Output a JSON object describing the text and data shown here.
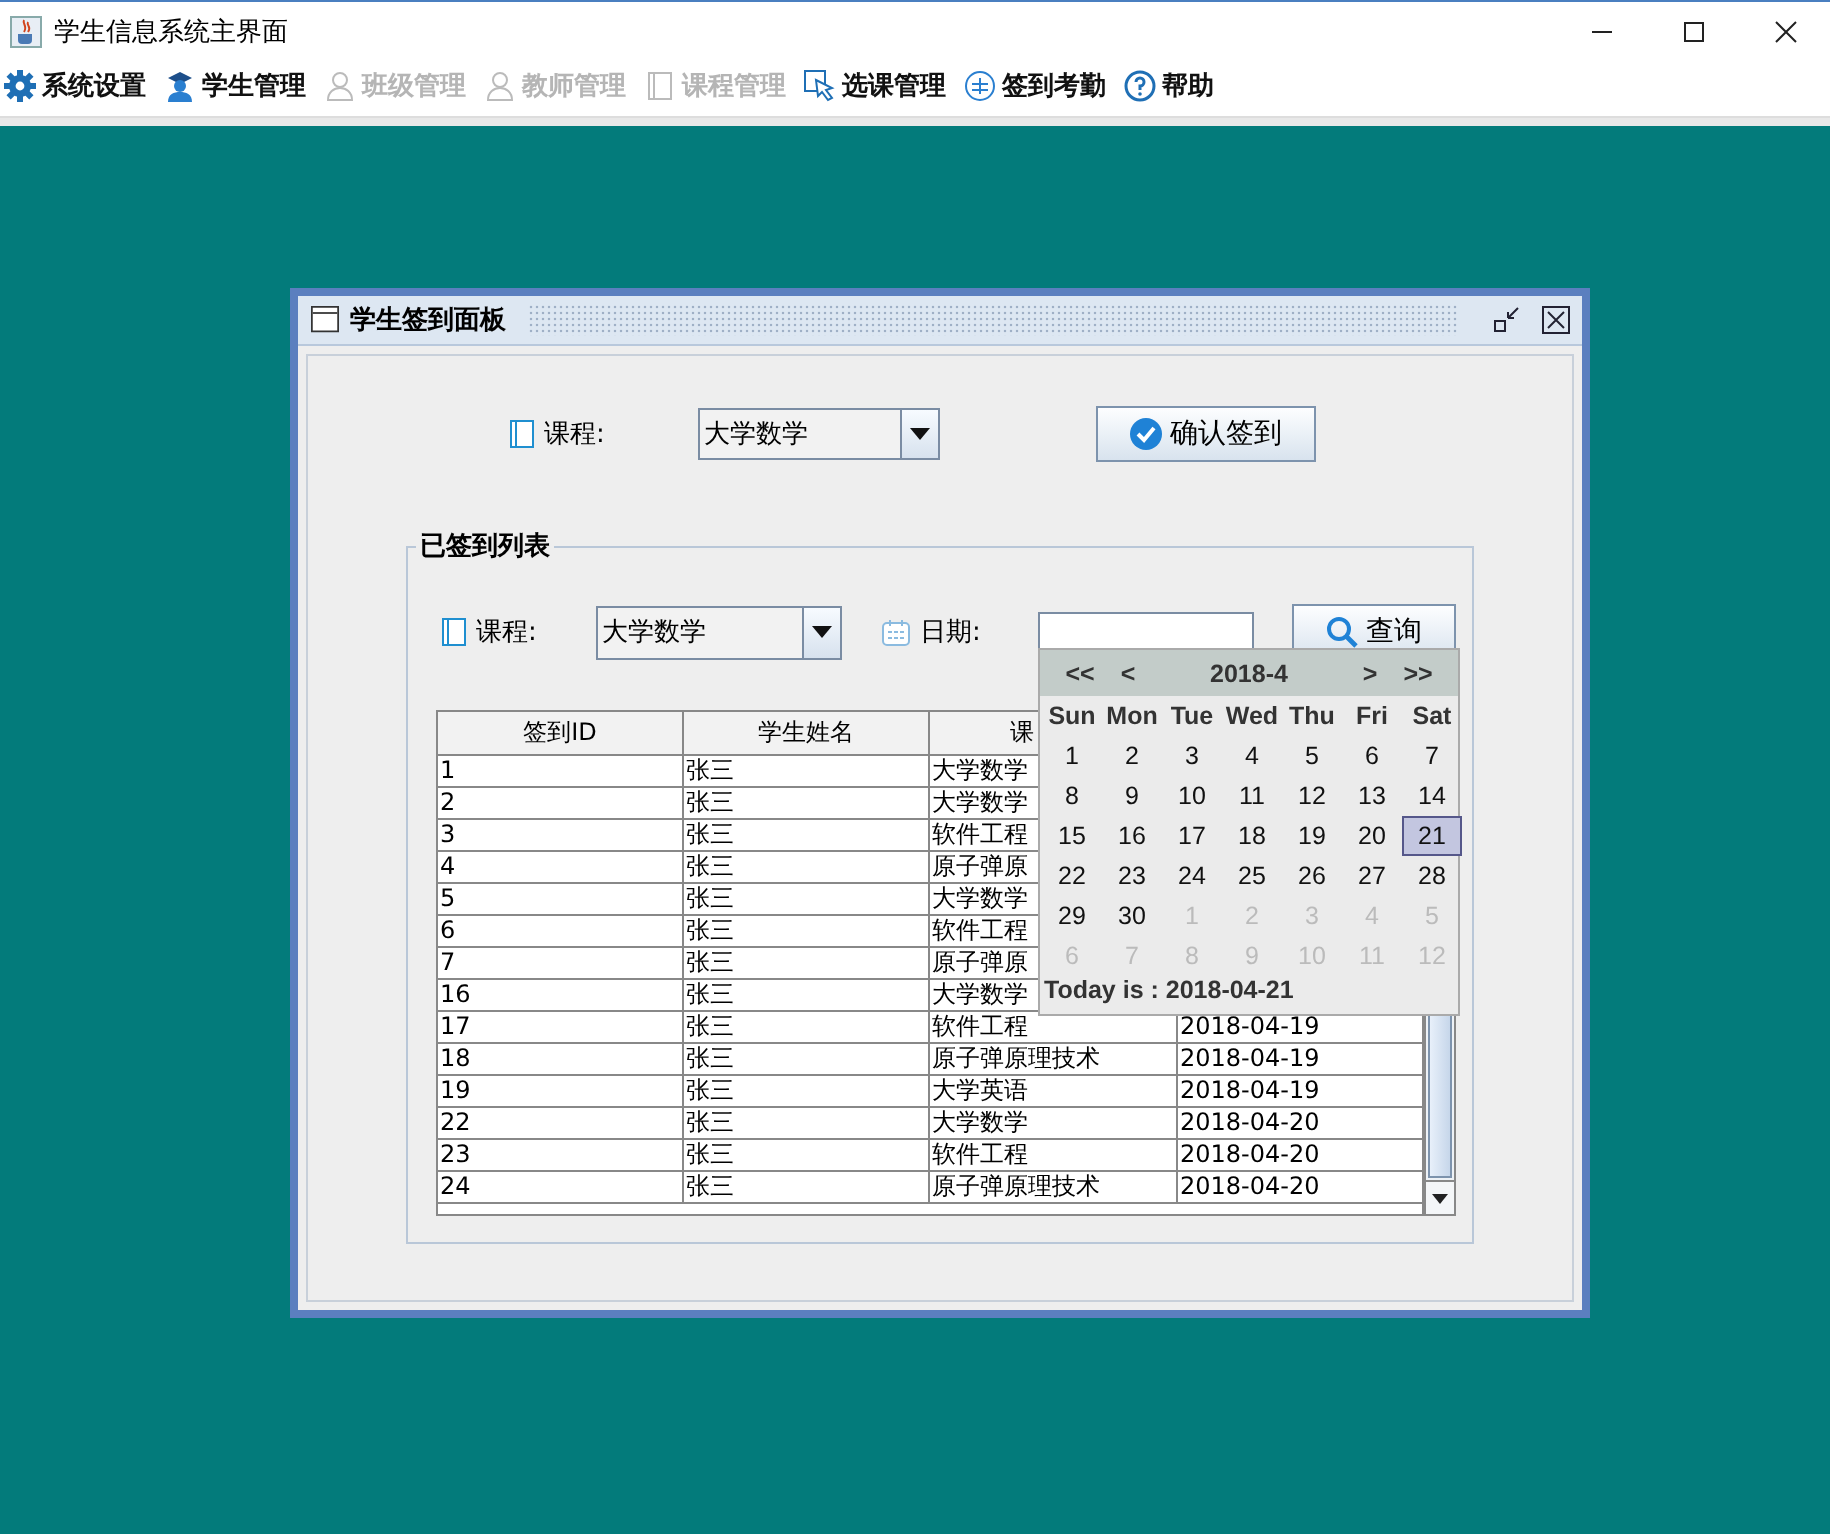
{
  "window": {
    "title": "学生信息系统主界面"
  },
  "menu": [
    {
      "label": "系统设置",
      "disabled": false
    },
    {
      "label": "学生管理",
      "disabled": false
    },
    {
      "label": "班级管理",
      "disabled": true
    },
    {
      "label": "教师管理",
      "disabled": true
    },
    {
      "label": "课程管理",
      "disabled": true
    },
    {
      "label": "选课管理",
      "disabled": false
    },
    {
      "label": "签到考勤",
      "disabled": false
    },
    {
      "label": "帮助",
      "disabled": false
    }
  ],
  "panel": {
    "title": "学生签到面板",
    "sign_in": {
      "course_label": "课程:",
      "course_value": "大学数学",
      "button": "确认签到"
    },
    "list": {
      "title": "已签到列表",
      "course_label": "课程:",
      "course_value": "大学数学",
      "date_label": "日期:",
      "search_button": "查询",
      "columns": [
        "签到ID",
        "学生姓名",
        "课"
      ],
      "rows": [
        {
          "id": "1",
          "name": "张三",
          "course": "大学数学"
        },
        {
          "id": "2",
          "name": "张三",
          "course": "大学数学"
        },
        {
          "id": "3",
          "name": "张三",
          "course": "软件工程"
        },
        {
          "id": "4",
          "name": "张三",
          "course": "原子弹原"
        },
        {
          "id": "5",
          "name": "张三",
          "course": "大学数学"
        },
        {
          "id": "6",
          "name": "张三",
          "course": "软件工程"
        },
        {
          "id": "7",
          "name": "张三",
          "course": "原子弹原"
        },
        {
          "id": "16",
          "name": "张三",
          "course": "大学数学"
        },
        {
          "id": "17",
          "name": "张三",
          "course": "软件工程",
          "date": "2018-04-19"
        },
        {
          "id": "18",
          "name": "张三",
          "course": "原子弹原理技术",
          "date": "2018-04-19"
        },
        {
          "id": "19",
          "name": "张三",
          "course": "大学英语",
          "date": "2018-04-19"
        },
        {
          "id": "22",
          "name": "张三",
          "course": "大学数学",
          "date": "2018-04-20"
        },
        {
          "id": "23",
          "name": "张三",
          "course": "软件工程",
          "date": "2018-04-20"
        },
        {
          "id": "24",
          "name": "张三",
          "course": "原子弹原理技术",
          "date": "2018-04-20"
        }
      ],
      "calendar": {
        "nav": [
          "<<",
          "<",
          "2018-4",
          ">",
          ">>"
        ],
        "weekdays": [
          "Sun",
          "Mon",
          "Tue",
          "Wed",
          "Thu",
          "Fri",
          "Sat"
        ],
        "days": [
          {
            "label": "1",
            "outside": false,
            "selected": false
          },
          {
            "label": "2",
            "outside": false,
            "selected": false
          },
          {
            "label": "3",
            "outside": false,
            "selected": false
          },
          {
            "label": "4",
            "outside": false,
            "selected": false
          },
          {
            "label": "5",
            "outside": false,
            "selected": false
          },
          {
            "label": "6",
            "outside": false,
            "selected": false
          },
          {
            "label": "7",
            "outside": false,
            "selected": false
          },
          {
            "label": "8",
            "outside": false,
            "selected": false
          },
          {
            "label": "9",
            "outside": false,
            "selected": false
          },
          {
            "label": "10",
            "outside": false,
            "selected": false
          },
          {
            "label": "11",
            "outside": false,
            "selected": false
          },
          {
            "label": "12",
            "outside": false,
            "selected": false
          },
          {
            "label": "13",
            "outside": false,
            "selected": false
          },
          {
            "label": "14",
            "outside": false,
            "selected": false
          },
          {
            "label": "15",
            "outside": false,
            "selected": false
          },
          {
            "label": "16",
            "outside": false,
            "selected": false
          },
          {
            "label": "17",
            "outside": false,
            "selected": false
          },
          {
            "label": "18",
            "outside": false,
            "selected": false
          },
          {
            "label": "19",
            "outside": false,
            "selected": false
          },
          {
            "label": "20",
            "outside": false,
            "selected": false
          },
          {
            "label": "21",
            "outside": false,
            "selected": true
          },
          {
            "label": "22",
            "outside": false,
            "selected": false
          },
          {
            "label": "23",
            "outside": false,
            "selected": false
          },
          {
            "label": "24",
            "outside": false,
            "selected": false
          },
          {
            "label": "25",
            "outside": false,
            "selected": false
          },
          {
            "label": "26",
            "outside": false,
            "selected": false
          },
          {
            "label": "27",
            "outside": false,
            "selected": false
          },
          {
            "label": "28",
            "outside": false,
            "selected": false
          },
          {
            "label": "29",
            "outside": false,
            "selected": false
          },
          {
            "label": "30",
            "outside": false,
            "selected": false
          },
          {
            "label": "1",
            "outside": true,
            "selected": false
          },
          {
            "label": "2",
            "outside": true,
            "selected": false
          },
          {
            "label": "3",
            "outside": true,
            "selected": false
          },
          {
            "label": "4",
            "outside": true,
            "selected": false
          },
          {
            "label": "5",
            "outside": true,
            "selected": false
          },
          {
            "label": "6",
            "outside": true,
            "selected": false
          },
          {
            "label": "7",
            "outside": true,
            "selected": false
          },
          {
            "label": "8",
            "outside": true,
            "selected": false
          },
          {
            "label": "9",
            "outside": true,
            "selected": false
          },
          {
            "label": "10",
            "outside": true,
            "selected": false
          },
          {
            "label": "11",
            "outside": true,
            "selected": false
          },
          {
            "label": "12",
            "outside": true,
            "selected": false
          }
        ],
        "today": "Today is : 2018-04-21"
      }
    }
  }
}
